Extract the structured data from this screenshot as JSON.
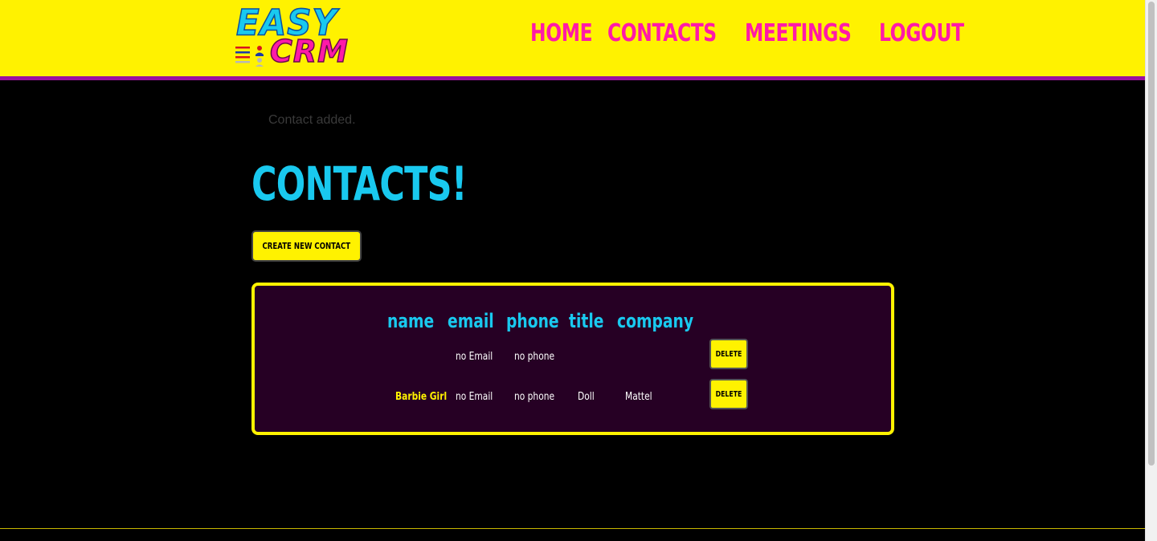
{
  "logo": {
    "line1": "EASY",
    "line2": "CRM"
  },
  "nav": [
    {
      "label": "HOME"
    },
    {
      "label": "CONTACTS"
    },
    {
      "label": "MEETINGS"
    },
    {
      "label": "LOGOUT"
    }
  ],
  "flash_message": "Contact added.",
  "page_title": "CONTACTS!",
  "create_button_label": "CREATE NEW CONTACT",
  "table": {
    "headers": [
      "name",
      "email",
      "phone",
      "title",
      "company"
    ],
    "rows": [
      {
        "name": "",
        "email": "no Email",
        "phone": "no phone",
        "title": "",
        "company": "",
        "action": "DELETE"
      },
      {
        "name": "Barbie Girl",
        "email": "no Email",
        "phone": "no phone",
        "title": "Doll",
        "company": "Mattel",
        "action": "DELETE"
      }
    ]
  },
  "colors": {
    "header_bg": "#fff200",
    "header_border": "#9b0f9e",
    "nav_link": "#ff1aa8",
    "title": "#19c9ef",
    "table_bg": "#260024",
    "table_border": "#fff200"
  }
}
